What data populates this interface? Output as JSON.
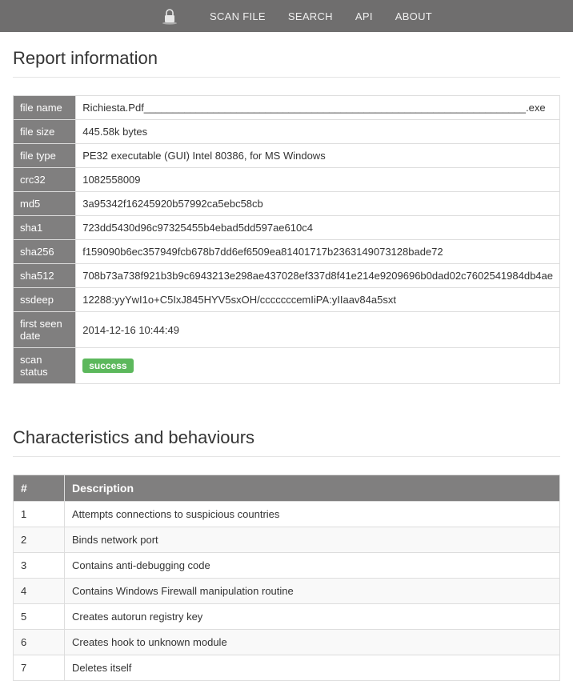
{
  "nav": {
    "items": [
      "SCAN FILE",
      "SEARCH",
      "API",
      "ABOUT"
    ]
  },
  "sections": {
    "report_title": "Report information",
    "behav_title": "Characteristics and behaviours"
  },
  "report": {
    "rows": [
      {
        "key": "file name",
        "val": "Richiesta.Pdf__________________________________________________________________.exe"
      },
      {
        "key": "file size",
        "val": "445.58k bytes"
      },
      {
        "key": "file type",
        "val": "PE32 executable (GUI) Intel 80386, for MS Windows"
      },
      {
        "key": "crc32",
        "val": "1082558009"
      },
      {
        "key": "md5",
        "val": "3a95342f16245920b57992ca5ebc58cb"
      },
      {
        "key": "sha1",
        "val": "723dd5430d96c97325455b4ebad5dd597ae610c4"
      },
      {
        "key": "sha256",
        "val": "f159090b6ec357949fcb678b7dd6ef6509ea81401717b2363149073128bade72"
      },
      {
        "key": "sha512",
        "val": "708b73a738f921b3b9c6943213e298ae437028ef337d8f41e214e9209696b0dad02c7602541984db4ae"
      },
      {
        "key": "ssdeep",
        "val": "12288:yyYwI1o+C5IxJ845HYV5sxOH/cccccccemIiPA:yIIaav84a5sxt"
      },
      {
        "key": "first seen date",
        "val": "2014-12-16 10:44:49"
      },
      {
        "key": "scan status",
        "val": "success",
        "badge": true
      }
    ]
  },
  "behaviours": {
    "headers": {
      "num": "#",
      "desc": "Description"
    },
    "rows": [
      {
        "num": "1",
        "desc": "Attempts connections to suspicious countries"
      },
      {
        "num": "2",
        "desc": "Binds network port"
      },
      {
        "num": "3",
        "desc": "Contains anti-debugging code"
      },
      {
        "num": "4",
        "desc": "Contains Windows Firewall manipulation routine"
      },
      {
        "num": "5",
        "desc": "Creates autorun registry key"
      },
      {
        "num": "6",
        "desc": "Creates hook to unknown module"
      },
      {
        "num": "7",
        "desc": "Deletes itself"
      }
    ]
  }
}
